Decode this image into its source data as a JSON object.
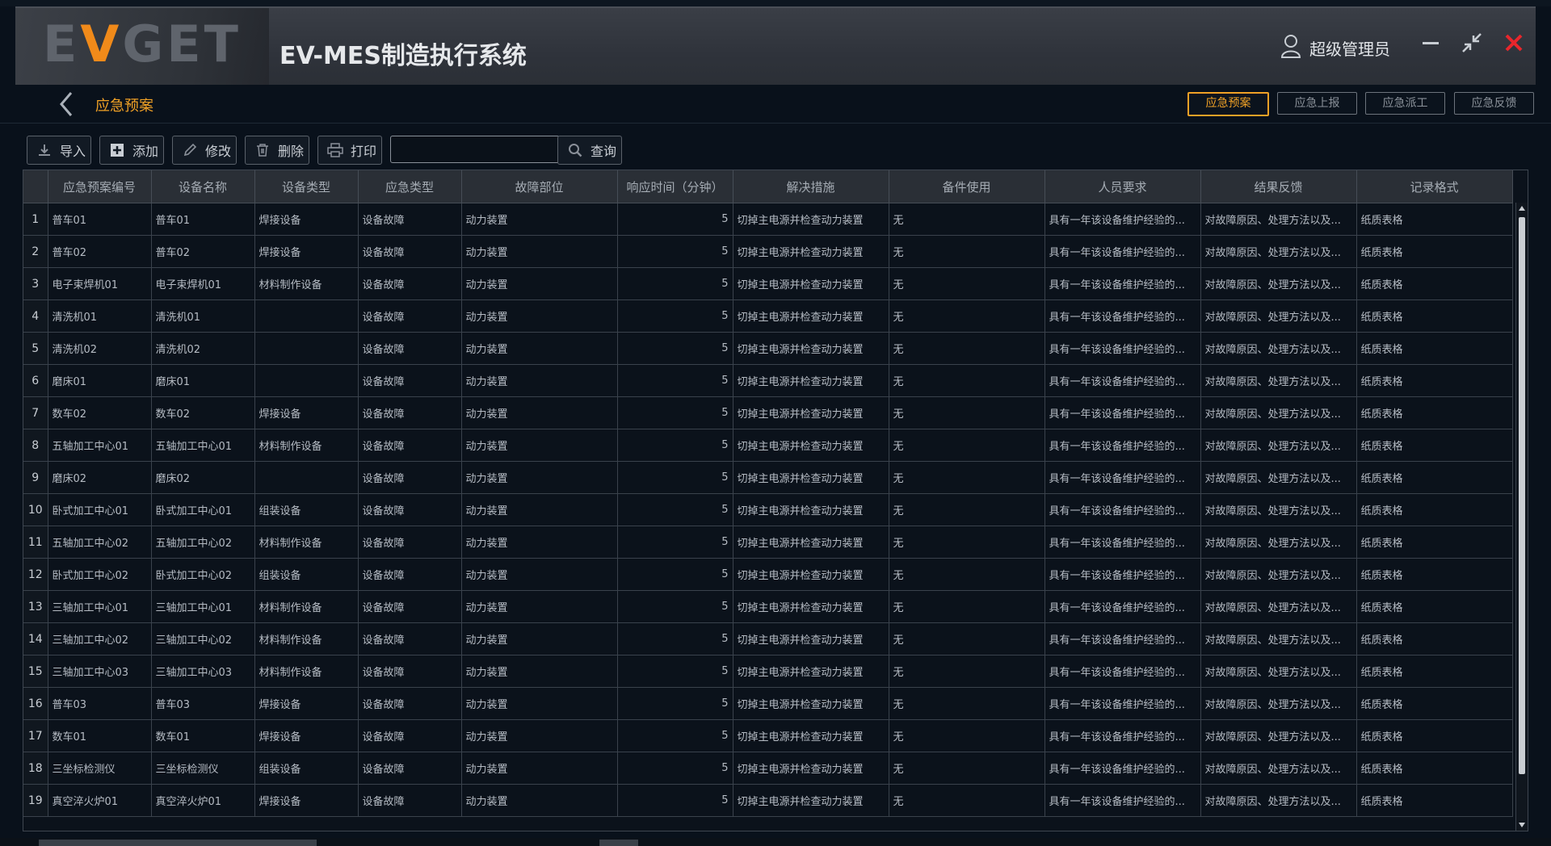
{
  "header": {
    "logo_text_pre": "E",
    "logo_text_accent": "V",
    "logo_text_post": "GET",
    "system_title": "EV-MES制造执行系统",
    "user_name": "超级管理员"
  },
  "colors": {
    "accent": "#f0a126",
    "close": "#e8262c",
    "background": "#09111b"
  },
  "icons": [
    "user-icon",
    "minimize-icon",
    "restore-icon",
    "close-icon",
    "back-chevron-icon",
    "import-icon",
    "add-icon",
    "edit-icon",
    "delete-icon",
    "print-icon",
    "search-icon"
  ],
  "breadcrumb": {
    "current": "应急预案"
  },
  "tabs": [
    {
      "label": "应急预案",
      "active": true
    },
    {
      "label": "应急上报",
      "active": false
    },
    {
      "label": "应急派工",
      "active": false
    },
    {
      "label": "应急反馈",
      "active": false
    }
  ],
  "toolbar": {
    "import": "导入",
    "add": "添加",
    "edit": "修改",
    "delete": "删除",
    "print": "打印",
    "search_value": "",
    "query": "查询"
  },
  "grid": {
    "columns": [
      "应急预案编号",
      "设备名称",
      "设备类型",
      "应急类型",
      "故障部位",
      "响应时间（分钟）",
      "解决措施",
      "备件使用",
      "人员要求",
      "结果反馈",
      "记录格式"
    ],
    "rows": [
      [
        "1",
        "普车01",
        "普车01",
        "焊接设备",
        "设备故障",
        "动力装置",
        "5",
        "切掉主电源并检查动力装置",
        "无",
        "具有一年该设备维护经验的...",
        "对故障原因、处理方法以及...",
        "纸质表格"
      ],
      [
        "2",
        "普车02",
        "普车02",
        "焊接设备",
        "设备故障",
        "动力装置",
        "5",
        "切掉主电源并检查动力装置",
        "无",
        "具有一年该设备维护经验的...",
        "对故障原因、处理方法以及...",
        "纸质表格"
      ],
      [
        "3",
        "电子束焊机01",
        "电子束焊机01",
        "材料制作设备",
        "设备故障",
        "动力装置",
        "5",
        "切掉主电源并检查动力装置",
        "无",
        "具有一年该设备维护经验的...",
        "对故障原因、处理方法以及...",
        "纸质表格"
      ],
      [
        "4",
        "清洗机01",
        "清洗机01",
        "",
        "设备故障",
        "动力装置",
        "5",
        "切掉主电源并检查动力装置",
        "无",
        "具有一年该设备维护经验的...",
        "对故障原因、处理方法以及...",
        "纸质表格"
      ],
      [
        "5",
        "清洗机02",
        "清洗机02",
        "",
        "设备故障",
        "动力装置",
        "5",
        "切掉主电源并检查动力装置",
        "无",
        "具有一年该设备维护经验的...",
        "对故障原因、处理方法以及...",
        "纸质表格"
      ],
      [
        "6",
        "磨床01",
        "磨床01",
        "",
        "设备故障",
        "动力装置",
        "5",
        "切掉主电源并检查动力装置",
        "无",
        "具有一年该设备维护经验的...",
        "对故障原因、处理方法以及...",
        "纸质表格"
      ],
      [
        "7",
        "数车02",
        "数车02",
        "焊接设备",
        "设备故障",
        "动力装置",
        "5",
        "切掉主电源并检查动力装置",
        "无",
        "具有一年该设备维护经验的...",
        "对故障原因、处理方法以及...",
        "纸质表格"
      ],
      [
        "8",
        "五轴加工中心01",
        "五轴加工中心01",
        "材料制作设备",
        "设备故障",
        "动力装置",
        "5",
        "切掉主电源并检查动力装置",
        "无",
        "具有一年该设备维护经验的...",
        "对故障原因、处理方法以及...",
        "纸质表格"
      ],
      [
        "9",
        "磨床02",
        "磨床02",
        "",
        "设备故障",
        "动力装置",
        "5",
        "切掉主电源并检查动力装置",
        "无",
        "具有一年该设备维护经验的...",
        "对故障原因、处理方法以及...",
        "纸质表格"
      ],
      [
        "10",
        "卧式加工中心01",
        "卧式加工中心01",
        "组装设备",
        "设备故障",
        "动力装置",
        "5",
        "切掉主电源并检查动力装置",
        "无",
        "具有一年该设备维护经验的...",
        "对故障原因、处理方法以及...",
        "纸质表格"
      ],
      [
        "11",
        "五轴加工中心02",
        "五轴加工中心02",
        "材料制作设备",
        "设备故障",
        "动力装置",
        "5",
        "切掉主电源并检查动力装置",
        "无",
        "具有一年该设备维护经验的...",
        "对故障原因、处理方法以及...",
        "纸质表格"
      ],
      [
        "12",
        "卧式加工中心02",
        "卧式加工中心02",
        "组装设备",
        "设备故障",
        "动力装置",
        "5",
        "切掉主电源并检查动力装置",
        "无",
        "具有一年该设备维护经验的...",
        "对故障原因、处理方法以及...",
        "纸质表格"
      ],
      [
        "13",
        "三轴加工中心01",
        "三轴加工中心01",
        "材料制作设备",
        "设备故障",
        "动力装置",
        "5",
        "切掉主电源并检查动力装置",
        "无",
        "具有一年该设备维护经验的...",
        "对故障原因、处理方法以及...",
        "纸质表格"
      ],
      [
        "14",
        "三轴加工中心02",
        "三轴加工中心02",
        "材料制作设备",
        "设备故障",
        "动力装置",
        "5",
        "切掉主电源并检查动力装置",
        "无",
        "具有一年该设备维护经验的...",
        "对故障原因、处理方法以及...",
        "纸质表格"
      ],
      [
        "15",
        "三轴加工中心03",
        "三轴加工中心03",
        "材料制作设备",
        "设备故障",
        "动力装置",
        "5",
        "切掉主电源并检查动力装置",
        "无",
        "具有一年该设备维护经验的...",
        "对故障原因、处理方法以及...",
        "纸质表格"
      ],
      [
        "16",
        "普车03",
        "普车03",
        "焊接设备",
        "设备故障",
        "动力装置",
        "5",
        "切掉主电源并检查动力装置",
        "无",
        "具有一年该设备维护经验的...",
        "对故障原因、处理方法以及...",
        "纸质表格"
      ],
      [
        "17",
        "数车01",
        "数车01",
        "焊接设备",
        "设备故障",
        "动力装置",
        "5",
        "切掉主电源并检查动力装置",
        "无",
        "具有一年该设备维护经验的...",
        "对故障原因、处理方法以及...",
        "纸质表格"
      ],
      [
        "18",
        "三坐标检测仪",
        "三坐标检测仪",
        "组装设备",
        "设备故障",
        "动力装置",
        "5",
        "切掉主电源并检查动力装置",
        "无",
        "具有一年该设备维护经验的...",
        "对故障原因、处理方法以及...",
        "纸质表格"
      ],
      [
        "19",
        "真空淬火炉01",
        "真空淬火炉01",
        "焊接设备",
        "设备故障",
        "动力装置",
        "5",
        "切掉主电源并检查动力装置",
        "无",
        "具有一年该设备维护经验的...",
        "对故障原因、处理方法以及...",
        "纸质表格"
      ]
    ]
  }
}
